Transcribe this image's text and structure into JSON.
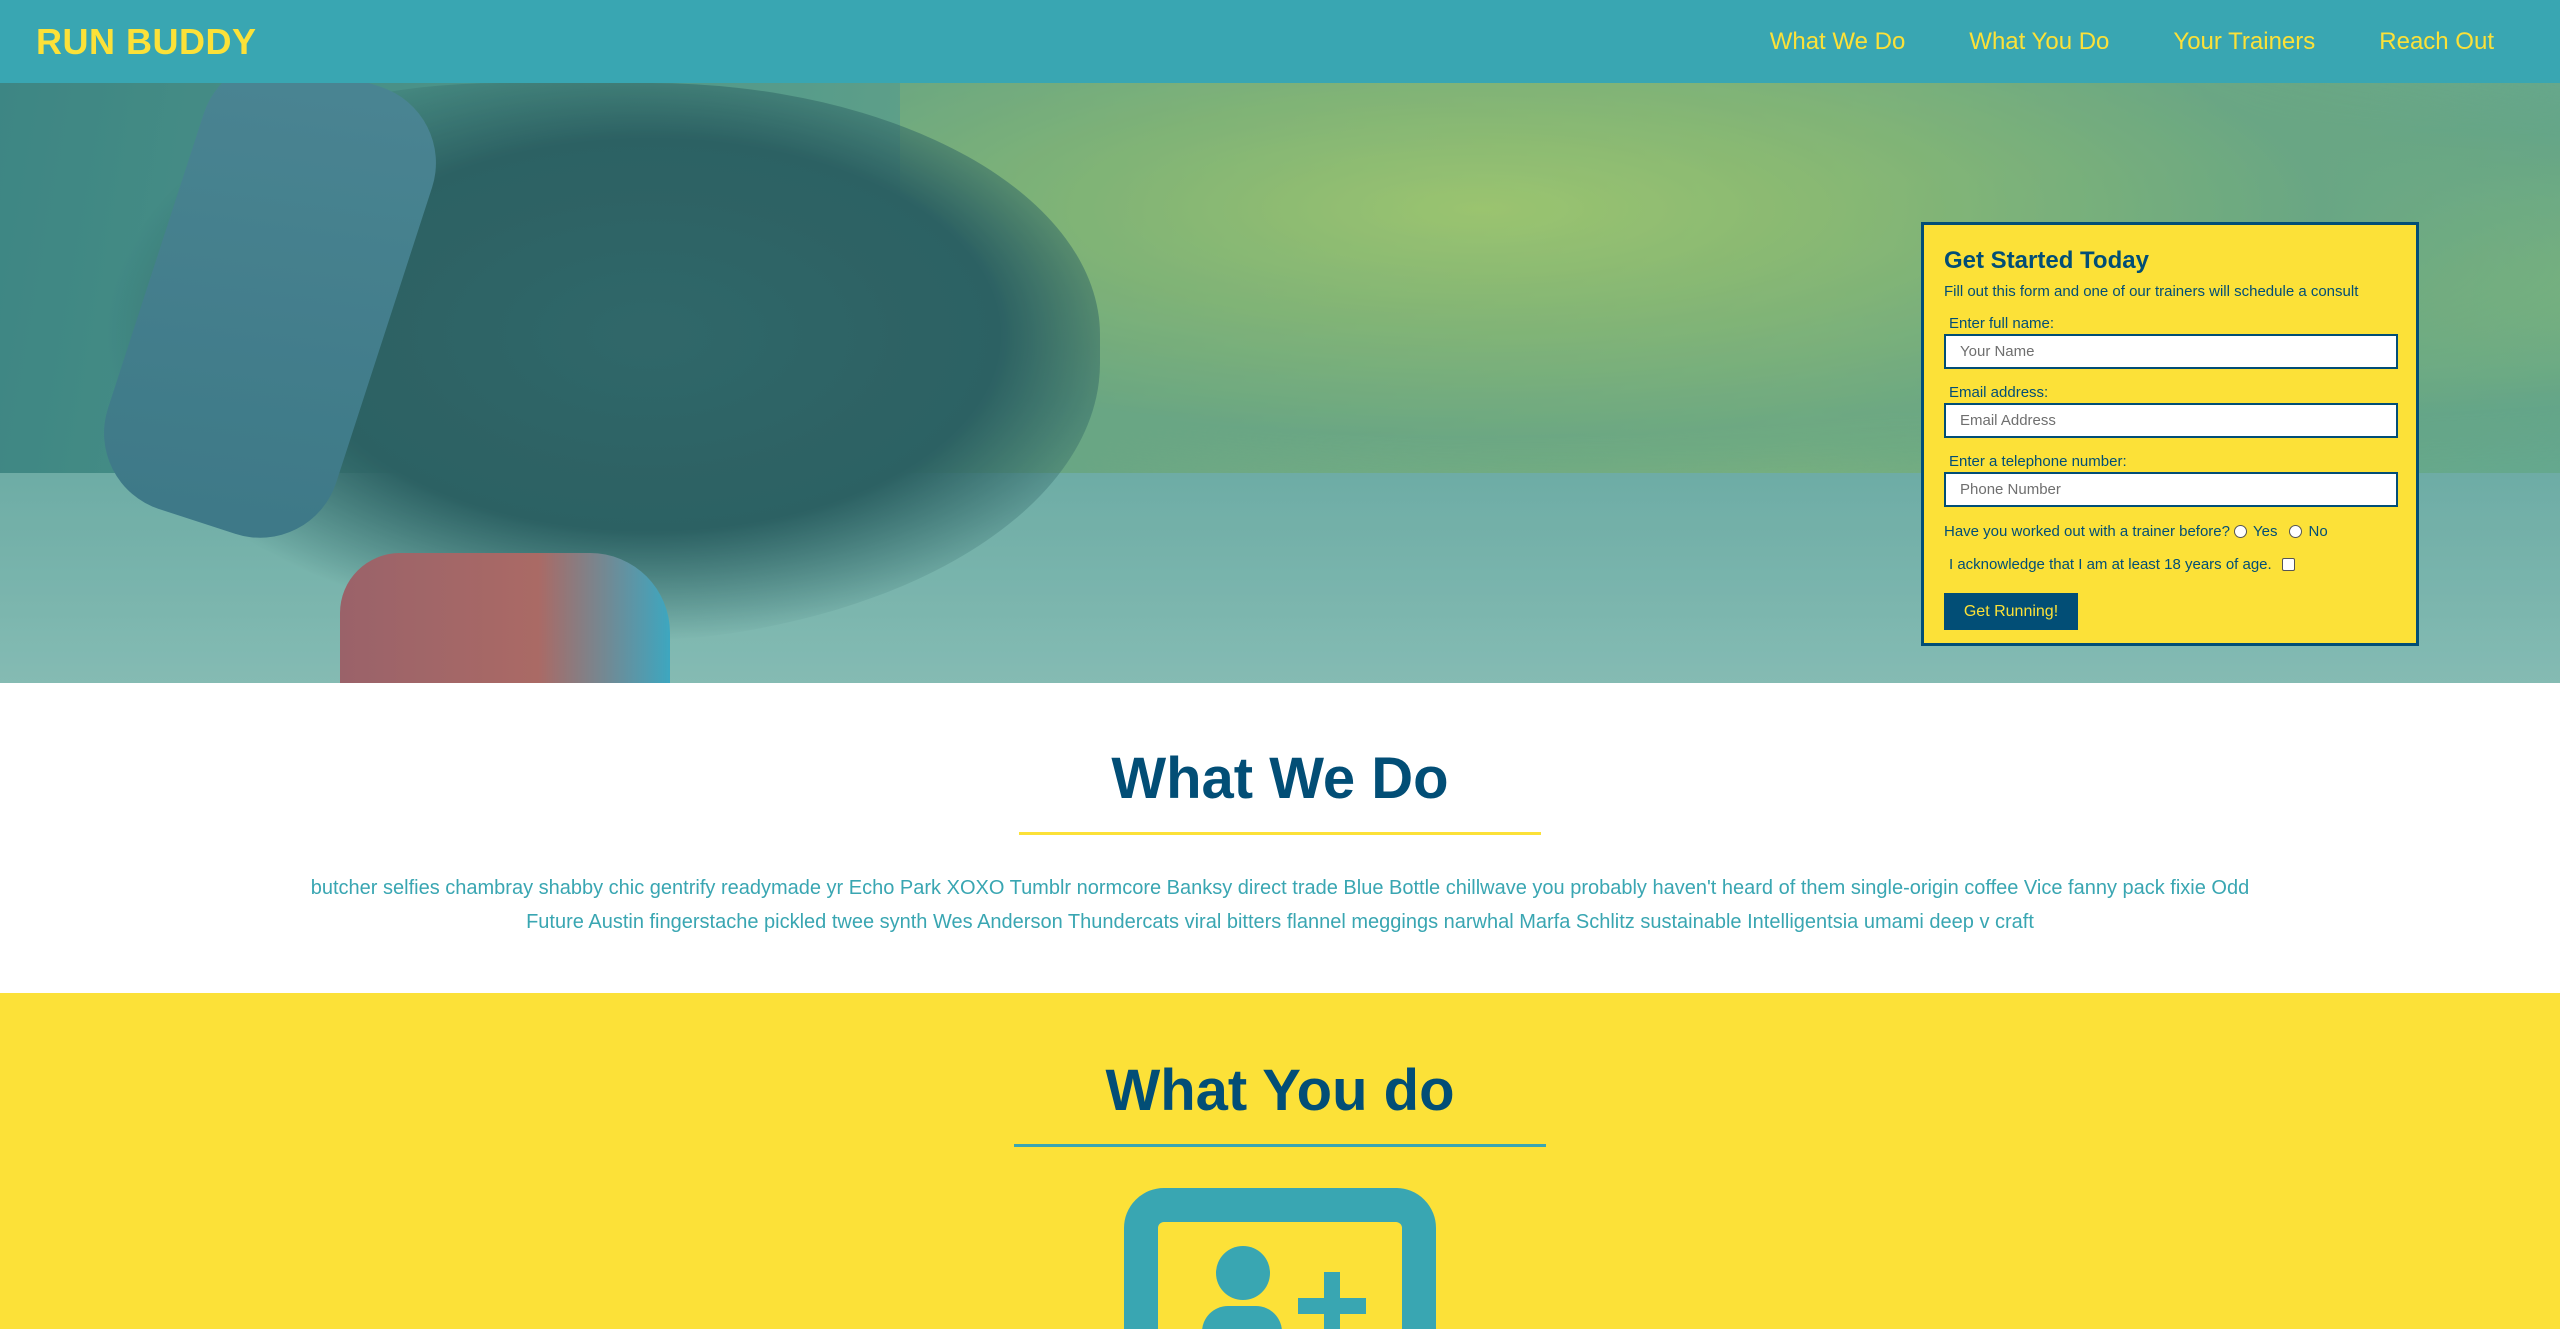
{
  "header": {
    "logo": "RUN BUDDY",
    "nav": [
      "What We Do",
      "What You Do",
      "Your Trainers",
      "Reach Out"
    ]
  },
  "form": {
    "title": "Get Started Today",
    "subtitle": "Fill out this form and one of our trainers will schedule a consult",
    "name_label": "Enter full name:",
    "name_placeholder": "Your Name",
    "email_label": "Email address:",
    "email_placeholder": "Email Address",
    "phone_label": "Enter a telephone number:",
    "phone_placeholder": "Phone Number",
    "trainer_question": "Have you worked out with a trainer before?",
    "yes_label": "Yes",
    "no_label": "No",
    "age_ack": "I acknowledge that I am at least 18 years of age.",
    "submit_label": "Get Running!"
  },
  "what_we_do": {
    "title": "What We Do",
    "text": "butcher selfies chambray shabby chic gentrify readymade yr Echo Park XOXO Tumblr normcore Banksy direct trade Blue Bottle chillwave you probably haven't heard of them single-origin coffee Vice fanny pack fixie Odd Future Austin fingerstache pickled twee synth Wes Anderson Thundercats viral bitters flannel meggings narwhal Marfa Schlitz sustainable Intelligentsia umami deep v craft"
  },
  "what_you_do": {
    "title": "What You do",
    "icon": "add-user-icon"
  },
  "colors": {
    "teal": "#39a6b2",
    "yellow": "#fce138",
    "navy": "#024e76"
  }
}
